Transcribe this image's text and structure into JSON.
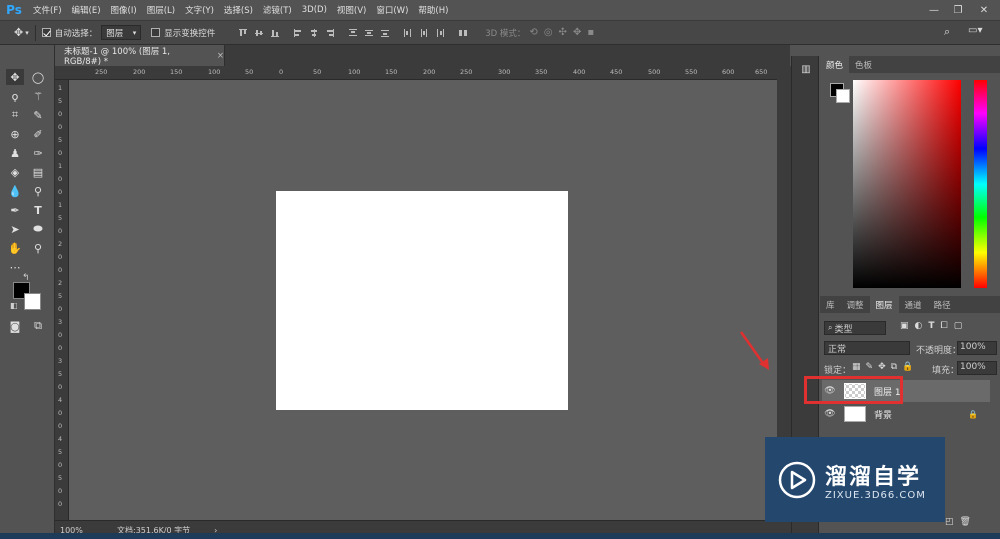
{
  "app": {
    "logo": "Ps"
  },
  "menu": [
    "文件(F)",
    "编辑(E)",
    "图像(I)",
    "图层(L)",
    "文字(Y)",
    "选择(S)",
    "滤镜(T)",
    "3D(D)",
    "视图(V)",
    "窗口(W)",
    "帮助(H)"
  ],
  "window_controls": {
    "minimize": "—",
    "restore": "❐",
    "close": "✕"
  },
  "options": {
    "auto_select_label": "自动选择：",
    "auto_select_checked": true,
    "auto_select_value": "图层",
    "transform_controls_label": "显示变换控件",
    "mode_3d_label": "3D 模式："
  },
  "document_tab": {
    "title": "未标题-1 @ 100% (图层 1, RGB/8#) *",
    "close": "×"
  },
  "ruler_h_ticks": [
    "250",
    "200",
    "150",
    "100",
    "50",
    "0",
    "50",
    "100",
    "150",
    "200",
    "250",
    "300",
    "350",
    "400",
    "450",
    "500",
    "550",
    "600",
    "650"
  ],
  "ruler_v_ticks": [
    "1",
    "5",
    "0",
    "0",
    "5",
    "0",
    "1",
    "0",
    "0",
    "1",
    "5",
    "0",
    "2",
    "0",
    "0",
    "2",
    "5",
    "0",
    "3",
    "0",
    "0",
    "3",
    "5",
    "0",
    "4",
    "0",
    "0",
    "4",
    "5",
    "0",
    "5",
    "0",
    "0"
  ],
  "status": {
    "zoom": "100%",
    "doc_info": "文档:351.6K/0 字节",
    "arrow": "›"
  },
  "color_panel": {
    "tabs": [
      "颜色",
      "色板"
    ],
    "foreground": "#000000",
    "background": "#ffffff"
  },
  "layers_panel": {
    "tabs": [
      "库",
      "调整",
      "图层",
      "通道",
      "路径"
    ],
    "filter_kind": "类型",
    "blend_mode": "正常",
    "opacity_label": "不透明度：",
    "opacity_value": "100%",
    "lock_label": "锁定：",
    "fill_label": "填充：",
    "fill_value": "100%",
    "layers": [
      {
        "name": "图层 1",
        "selected": true,
        "locked": false
      },
      {
        "name": "背景",
        "selected": false,
        "locked": true
      }
    ]
  },
  "watermark": {
    "title": "溜溜自学",
    "url": "ZIXUE.3D66.COM"
  },
  "colors": {
    "accent": "#31a8ff",
    "annotation": "#e03030",
    "watermark_bg": "#24476e"
  }
}
